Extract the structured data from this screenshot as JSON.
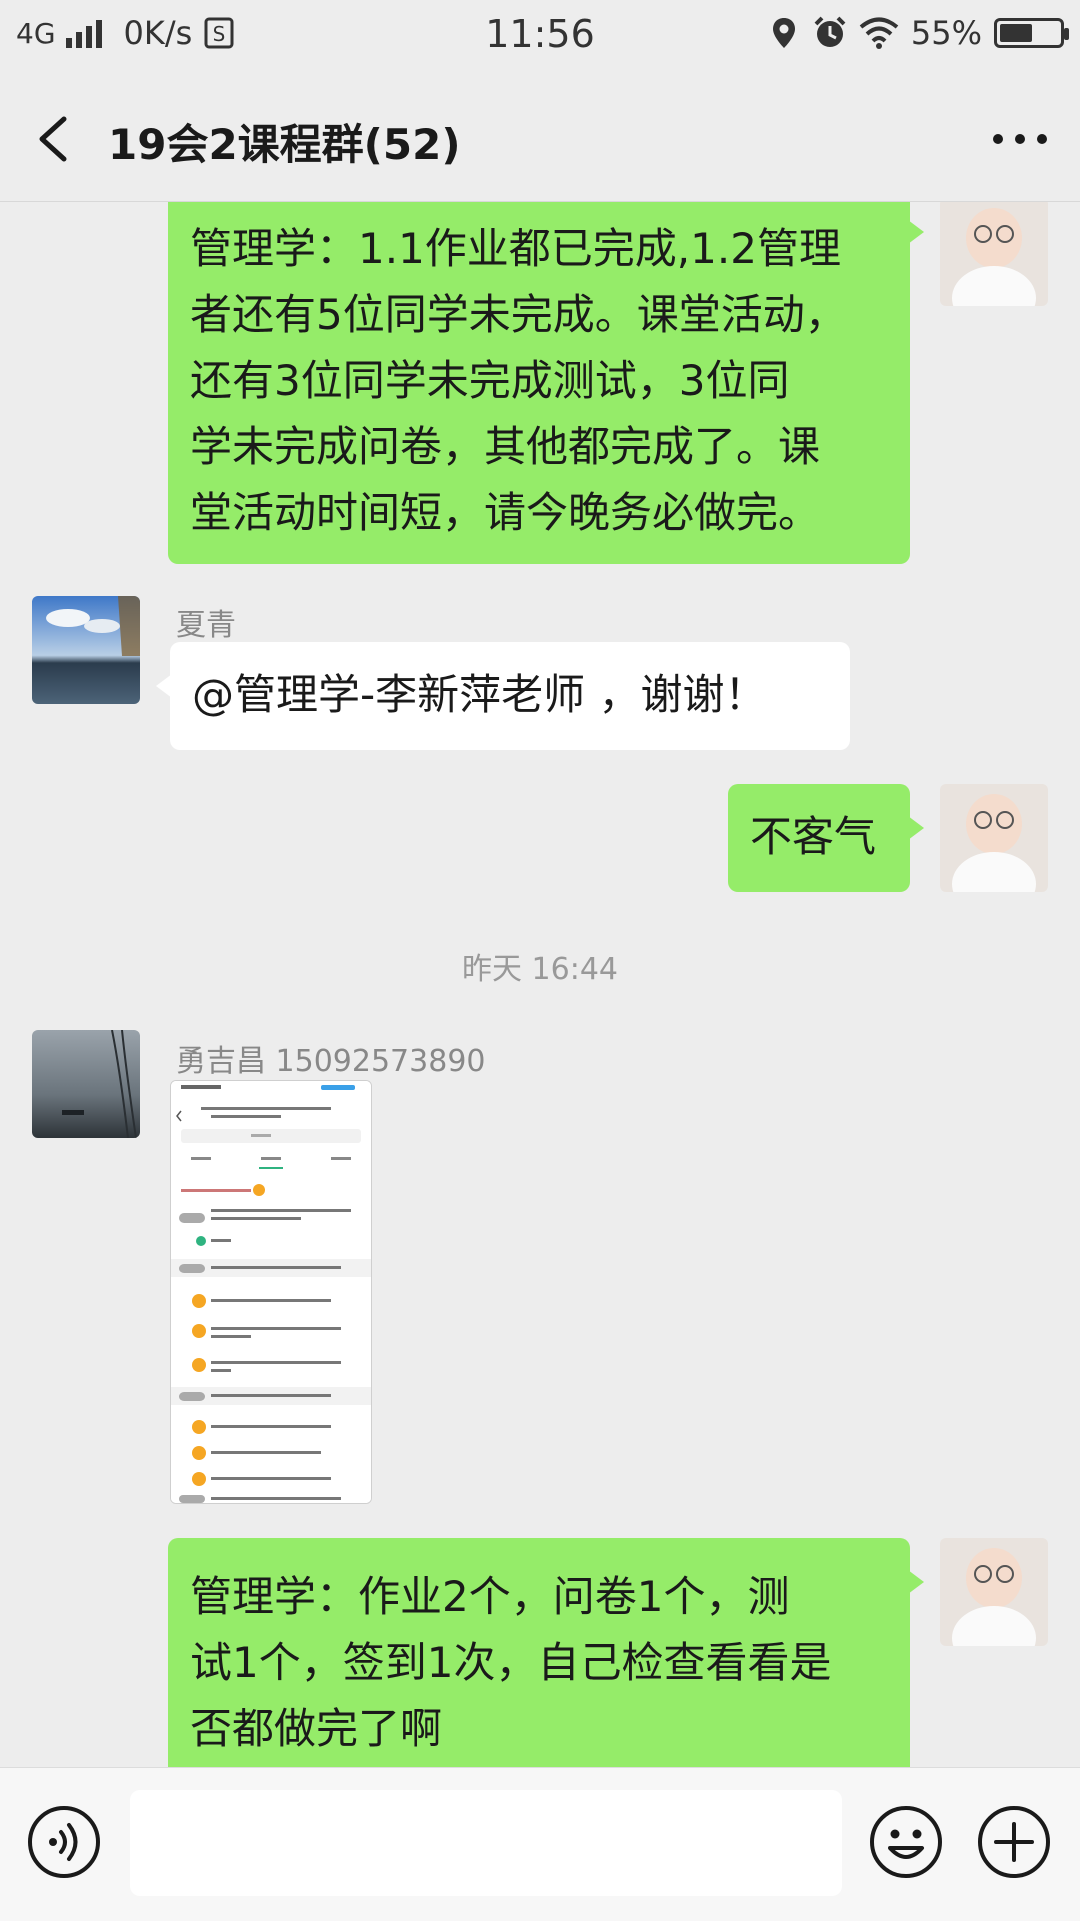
{
  "status_bar": {
    "network": "4G",
    "speed": "0K/s",
    "time": "11:56",
    "battery": "55%",
    "battery_level": 0.55
  },
  "header": {
    "title": "19会2课程群(52)"
  },
  "messages": [
    {
      "side": "right",
      "lines": [
        "管理学：1.1作业都已完成,1.2管理",
        "者还有5位同学未完成。课堂活动，",
        "还有3位同学未完成测试，3位同",
        "学未完成问卷，其他都完成了。课",
        "堂活动时间短，请今晚务必做完。"
      ]
    },
    {
      "side": "left",
      "sender": "夏青",
      "text": "@管理学-李新萍老师 ，谢谢！"
    },
    {
      "side": "right",
      "text": "不客气"
    },
    {
      "timestamp": "昨天 16:44"
    },
    {
      "side": "left",
      "sender": "勇吉昌 15092573890",
      "type": "image"
    },
    {
      "side": "right",
      "lines": [
        "管理学：作业2个，问卷1个，测",
        "试1个，签到1次，自己检查看看是",
        "否都做完了啊"
      ]
    }
  ],
  "input": {
    "placeholder": ""
  },
  "colors": {
    "background": "#ededed",
    "my_bubble": "#95ec69",
    "other_bubble": "#ffffff"
  },
  "icons": [
    "back-icon",
    "more-icon",
    "voice-icon",
    "emoji-icon",
    "plus-icon",
    "signal-icon",
    "wifi-icon",
    "location-icon",
    "alarm-icon"
  ]
}
